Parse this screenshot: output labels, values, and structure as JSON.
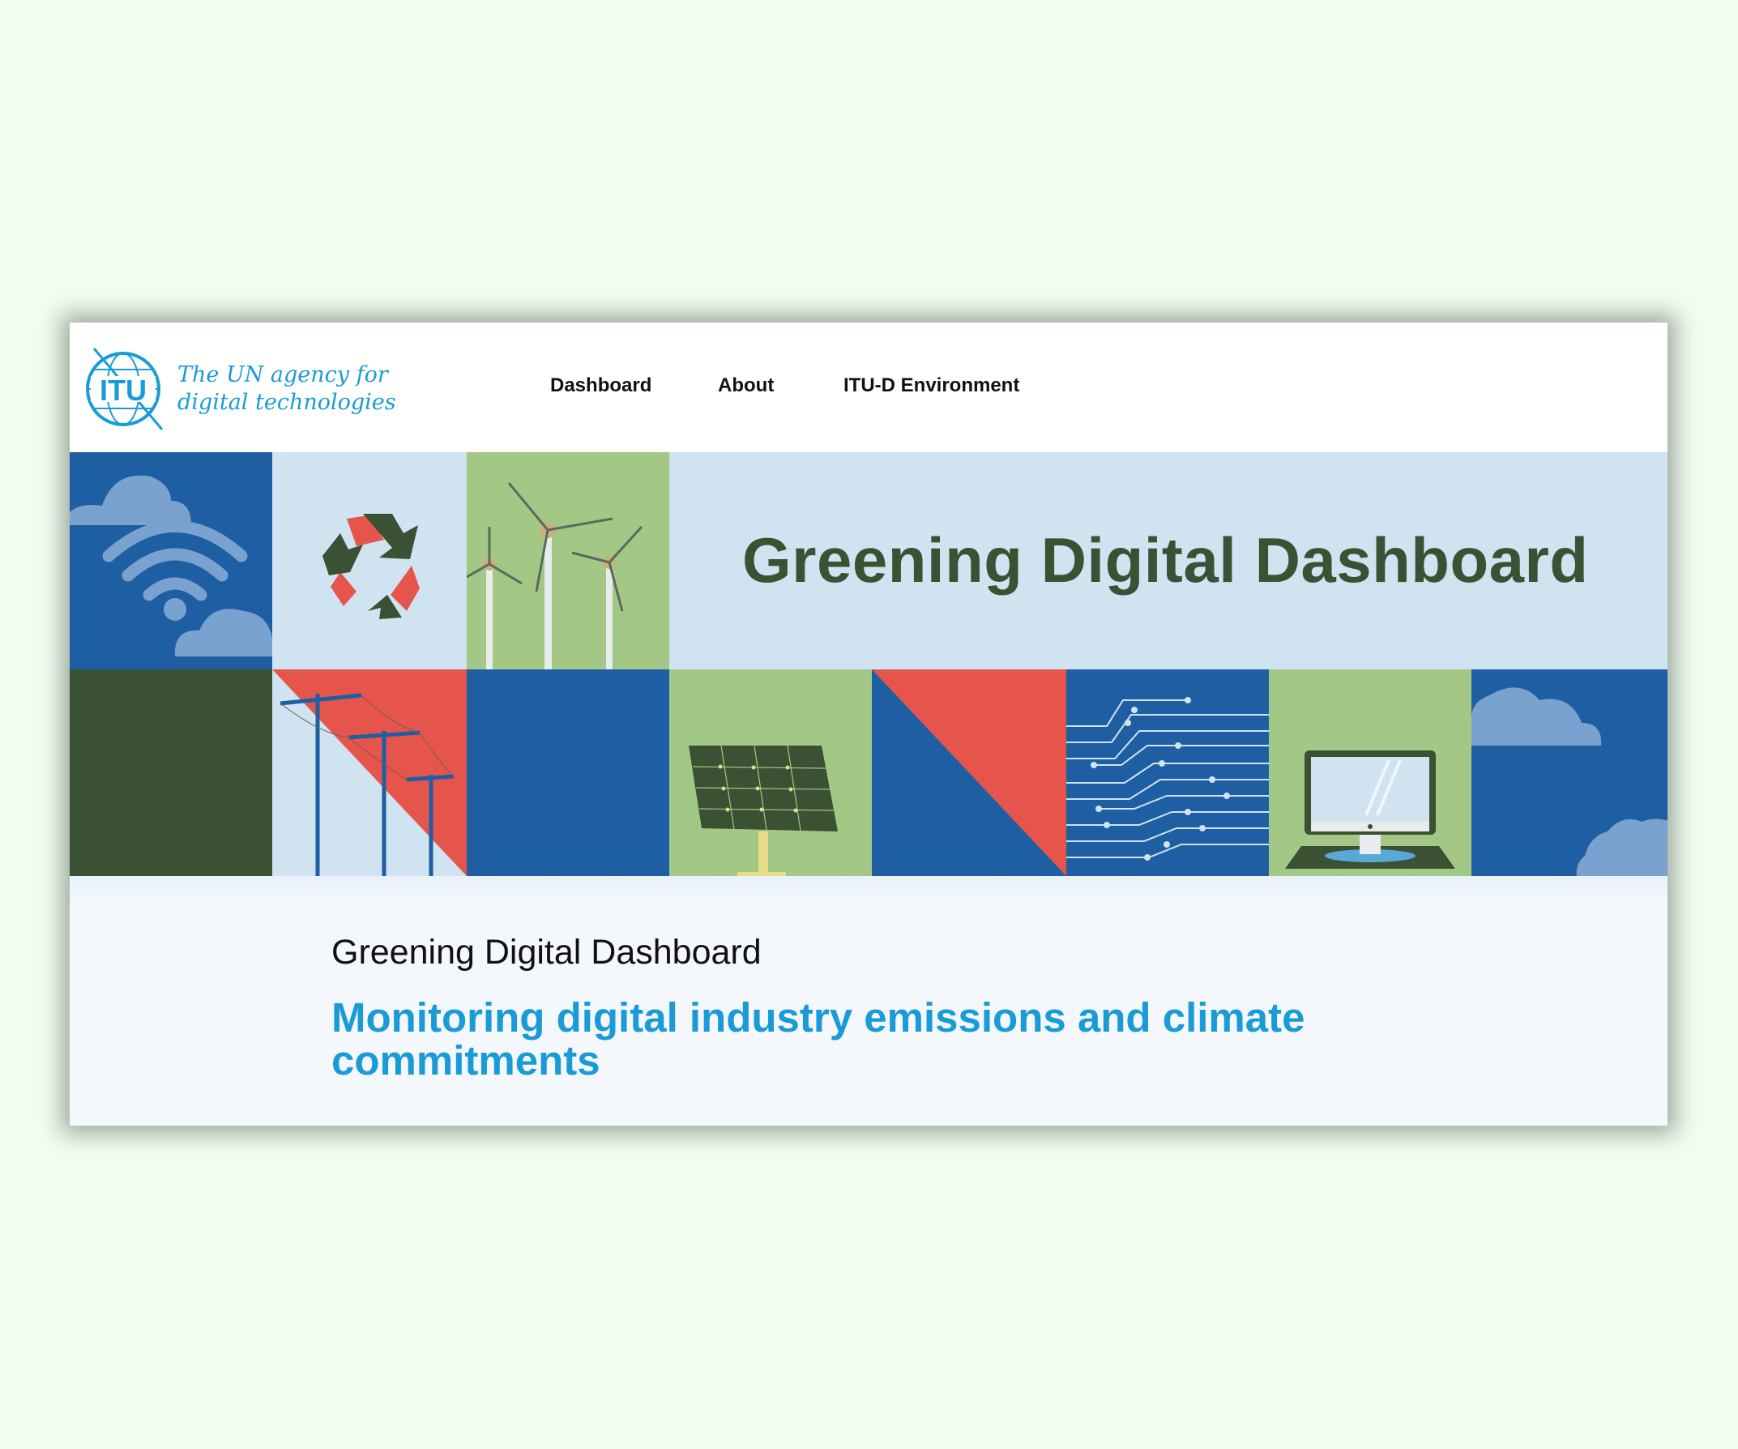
{
  "header": {
    "logo_text": "ITU",
    "tagline_line1": "The UN agency for",
    "tagline_line2": "digital technologies",
    "nav": [
      "Dashboard",
      "About",
      "ITU-D Environment"
    ]
  },
  "banner": {
    "title": "Greening Digital Dashboard",
    "tiles": [
      "wifi-cloud",
      "recycle",
      "wind-turbines",
      "power-lines",
      "solar-panel",
      "triangle",
      "circuit",
      "computer-monitor",
      "cloud"
    ]
  },
  "intro": {
    "title": "Greening Digital Dashboard",
    "subtitle": "Monitoring digital industry emissions and climate commitments"
  },
  "colors": {
    "navy": "#1e5fa3",
    "dark_green": "#3b5134",
    "light_green": "#a3c885",
    "light_blue": "#cfe3f0",
    "coral": "#e5554b",
    "itu_blue": "#1a9bd7"
  }
}
